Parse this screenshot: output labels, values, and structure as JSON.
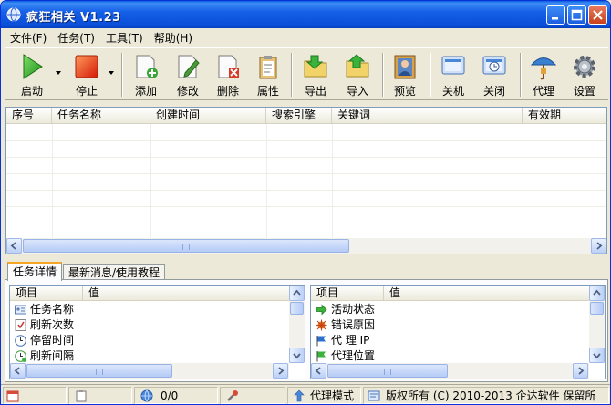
{
  "window": {
    "title": "疯狂相关 V1.23",
    "title_color": "#0a4fd8",
    "icons": {
      "minimize": "minimize-icon",
      "maximize": "maximize-icon",
      "close": "close-icon",
      "app": "globe-icon"
    }
  },
  "menu": [
    {
      "label": "文件(F)"
    },
    {
      "label": "任务(T)"
    },
    {
      "label": "工具(T)"
    },
    {
      "label": "帮助(H)"
    }
  ],
  "toolbar": {
    "start": {
      "label": "启动",
      "icon": "play-icon"
    },
    "stop": {
      "label": "停止",
      "icon": "stop-icon"
    },
    "add": {
      "label": "添加",
      "icon": "add-document-icon"
    },
    "edit": {
      "label": "修改",
      "icon": "edit-document-icon"
    },
    "delete": {
      "label": "删除",
      "icon": "delete-document-icon"
    },
    "properties": {
      "label": "属性",
      "icon": "clipboard-icon"
    },
    "export": {
      "label": "导出",
      "icon": "export-folder-icon"
    },
    "import": {
      "label": "导入",
      "icon": "import-folder-icon"
    },
    "preview": {
      "label": "预览",
      "icon": "preview-person-icon"
    },
    "shutdown": {
      "label": "关机",
      "icon": "monitor-icon"
    },
    "close": {
      "label": "关闭",
      "icon": "clock-icon"
    },
    "proxy": {
      "label": "代理",
      "icon": "umbrella-icon"
    },
    "settings": {
      "label": "设置",
      "icon": "gear-icon"
    }
  },
  "task_list": {
    "columns": [
      "序号",
      "任务名称",
      "创建时间",
      "搜索引擎",
      "关键词",
      "有效期"
    ],
    "rows": []
  },
  "tabs": [
    {
      "label": "任务详情",
      "active": true
    },
    {
      "label": "最新消息/使用教程",
      "active": false
    }
  ],
  "detail_left": {
    "columns": [
      "项目",
      "值"
    ],
    "rows": [
      {
        "item": "任务名称",
        "value": "",
        "icon": "card-icon"
      },
      {
        "item": "刷新次数",
        "value": "",
        "icon": "refresh-count-icon"
      },
      {
        "item": "停留时间",
        "value": "",
        "icon": "stay-clock-icon"
      },
      {
        "item": "刷新间隔",
        "value": "",
        "icon": "interval-clock-icon"
      }
    ]
  },
  "detail_right": {
    "columns": [
      "项目",
      "值"
    ],
    "rows": [
      {
        "item": "活动状态",
        "value": "",
        "icon": "green-arrow-icon"
      },
      {
        "item": "错误原因",
        "value": "",
        "icon": "error-bug-icon"
      },
      {
        "item": "代 理 IP",
        "value": "",
        "icon": "blue-flag-icon"
      },
      {
        "item": "代理位置",
        "value": "",
        "icon": "green-flag-icon"
      }
    ]
  },
  "statusbar": {
    "progress": "0/0",
    "mode": "代理模式",
    "copyright": "版权所有 (C) 2010-2013 企达软件 保留所"
  },
  "colors": {
    "titlebar": "#0a4fd8",
    "window_bg": "#ece9d8",
    "tab_accent": "#f5a627"
  }
}
